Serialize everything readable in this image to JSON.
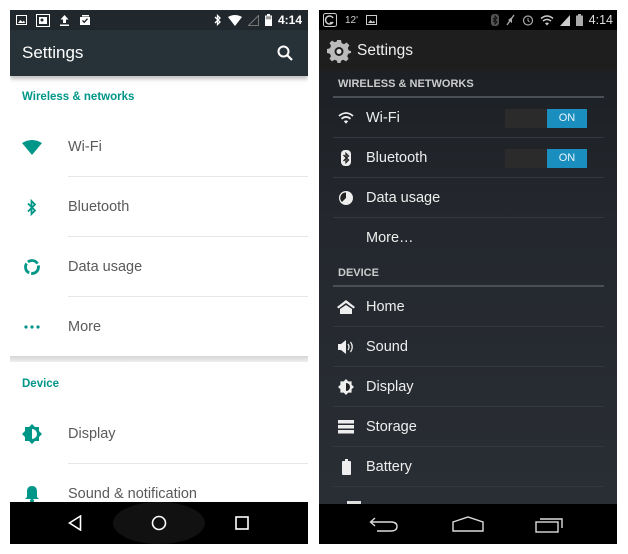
{
  "left_phone": {
    "status_bar": {
      "left_icons": [
        "gallery-icon",
        "screenshot-icon",
        "upload-icon",
        "task-done-icon"
      ],
      "right_icons": [
        "bluetooth-icon",
        "wifi-icon",
        "signal-icon",
        "battery-icon"
      ],
      "time": "4:14"
    },
    "app_bar": {
      "title": "Settings",
      "search_icon": "search-icon"
    },
    "sections": [
      {
        "title": "Wireless & networks",
        "items": [
          {
            "label": "Wi-Fi",
            "icon": "wifi-icon"
          },
          {
            "label": "Bluetooth",
            "icon": "bluetooth-icon"
          },
          {
            "label": "Data usage",
            "icon": "data-usage-icon"
          },
          {
            "label": "More",
            "icon": "more-icon"
          }
        ]
      },
      {
        "title": "Device",
        "items": [
          {
            "label": "Display",
            "icon": "display-icon"
          },
          {
            "label": "Sound & notification",
            "icon": "bell-icon"
          }
        ]
      }
    ],
    "nav_bar": [
      "back-icon",
      "home-icon",
      "recents-icon"
    ],
    "accent_color": "#009688"
  },
  "right_phone": {
    "status_bar": {
      "left_icons": [
        "app-notification-icon",
        "weather-icon",
        "gallery-icon"
      ],
      "temperature": "12'",
      "right_icons": [
        "bluetooth-icon",
        "mute-icon",
        "alarm-icon",
        "wifi-icon",
        "signal-icon",
        "battery-icon"
      ],
      "time": "4:14"
    },
    "app_bar": {
      "title": "Settings",
      "icon": "gear-icon"
    },
    "sections": [
      {
        "title": "WIRELESS & NETWORKS",
        "items": [
          {
            "label": "Wi-Fi",
            "icon": "wifi-icon",
            "toggle": "ON"
          },
          {
            "label": "Bluetooth",
            "icon": "bluetooth-icon",
            "toggle": "ON"
          },
          {
            "label": "Data usage",
            "icon": "data-usage-icon"
          },
          {
            "label": "More…",
            "icon": ""
          }
        ]
      },
      {
        "title": "DEVICE",
        "items": [
          {
            "label": "Home",
            "icon": "home-icon"
          },
          {
            "label": "Sound",
            "icon": "speaker-icon"
          },
          {
            "label": "Display",
            "icon": "display-icon"
          },
          {
            "label": "Storage",
            "icon": "storage-icon"
          },
          {
            "label": "Battery",
            "icon": "battery-icon"
          }
        ]
      }
    ],
    "nav_bar": [
      "back-icon",
      "home-icon",
      "recents-icon"
    ],
    "accent_color": "#1a8fbf"
  }
}
